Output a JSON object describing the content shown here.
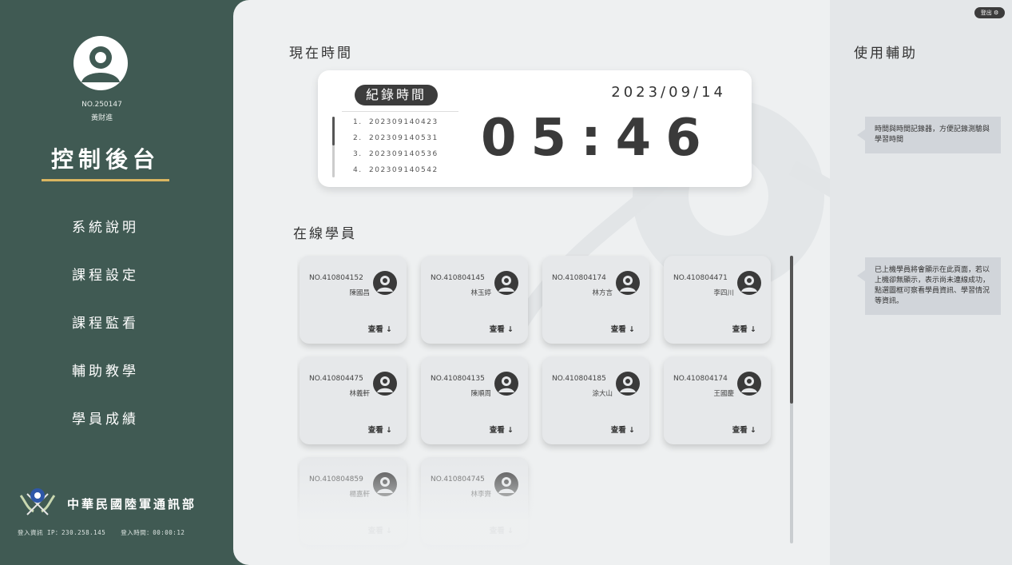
{
  "user": {
    "no": "NO.250147",
    "name": "黃財進"
  },
  "sidebar": {
    "title": "控制後台",
    "items": [
      {
        "label": "系統說明"
      },
      {
        "label": "課程設定"
      },
      {
        "label": "課程監看"
      },
      {
        "label": "輔助教學"
      },
      {
        "label": "學員成績"
      }
    ],
    "org_name": "中華民國陸軍通訊部",
    "login_ip": "登入資訊 IP：230.258.145",
    "login_time": "登入時間：00:00:12"
  },
  "clock": {
    "section_title": "現在時間",
    "record_label": "紀錄時間",
    "records": [
      {
        "idx": "1.",
        "value": "202309140423"
      },
      {
        "idx": "2.",
        "value": "202309140531"
      },
      {
        "idx": "3.",
        "value": "202309140536"
      },
      {
        "idx": "4.",
        "value": "202309140542"
      }
    ],
    "date": "2023/09/14",
    "time": "05:46"
  },
  "students": {
    "section_title": "在線學員",
    "view_label": "查看 ↓",
    "list": [
      {
        "no": "NO.410804152",
        "name": "陳國昌"
      },
      {
        "no": "NO.410804145",
        "name": "林玉婷"
      },
      {
        "no": "NO.410804174",
        "name": "林方言"
      },
      {
        "no": "NO.410804471",
        "name": "李四川"
      },
      {
        "no": "NO.410804475",
        "name": "林義軒"
      },
      {
        "no": "NO.410804135",
        "name": "陳順周"
      },
      {
        "no": "NO.410804185",
        "name": "涂大山"
      },
      {
        "no": "NO.410804174",
        "name": "王國慶"
      },
      {
        "no": "NO.410804859",
        "name": "楊嘉軒"
      },
      {
        "no": "NO.410804745",
        "name": "林李齊"
      }
    ]
  },
  "help": {
    "title": "使用輔助",
    "tip1": "時間與時間記錄器，方便記錄測驗與學習時間",
    "tip2": "已上機學員將會顯示在此頁面，若以上機卻無顯示，表示尚未連線成功，點選圖框可察看學員資訊、學習情況等資訊。"
  },
  "logout_label": "登出 ⚙",
  "colors": {
    "sidebar": "#405a53",
    "accent": "#d9b560",
    "dark": "#3c3c3c"
  }
}
